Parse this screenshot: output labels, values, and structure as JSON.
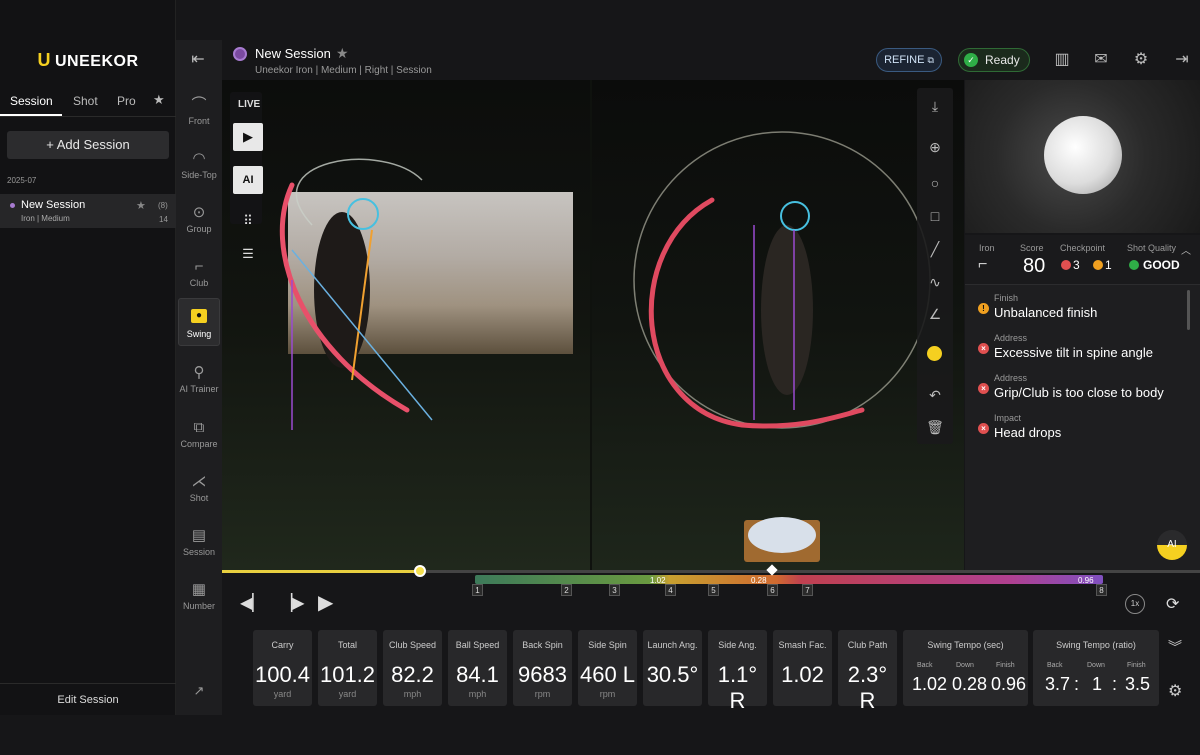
{
  "logo": {
    "mark": "U",
    "text": "UNEEKOR"
  },
  "left_tabs": [
    "Session",
    "Shot",
    "Pro"
  ],
  "add_session": "+ Add Session",
  "date_group": "2025-07",
  "session_item": {
    "title": "New Session",
    "sub": "Iron | Medium",
    "count_top": "(8)",
    "count_bottom": "14"
  },
  "edit_session": "Edit Session",
  "nav": [
    {
      "label": "Front",
      "icon": "front-view-icon"
    },
    {
      "label": "Side-Top",
      "icon": "side-top-view-icon"
    },
    {
      "label": "Group",
      "icon": "group-icon"
    },
    {
      "label": "Club",
      "icon": "club-icon"
    },
    {
      "label": "Swing",
      "icon": "camera-icon"
    },
    {
      "label": "AI Trainer",
      "icon": "ai-trainer-icon"
    },
    {
      "label": "Compare",
      "icon": "compare-icon"
    },
    {
      "label": "Shot",
      "icon": "shot-icon"
    },
    {
      "label": "Session",
      "icon": "session-icon"
    },
    {
      "label": "Number",
      "icon": "number-icon"
    }
  ],
  "header": {
    "title": "New Session",
    "subtitle": "Uneekor   Iron | Medium | Right | Session",
    "refine": "REFINE",
    "ready": "Ready"
  },
  "video": {
    "live": "LIVE",
    "ai": "AI"
  },
  "score": {
    "club_label": "Iron",
    "score_label": "Score",
    "score": "80",
    "checkpoint_label": "Checkpoint",
    "checkpoint_err": "3",
    "checkpoint_warn": "1",
    "quality_label": "Shot Quality",
    "quality": "GOOD"
  },
  "checkpoints": [
    {
      "cat": "Finish",
      "text": "Unbalanced finish",
      "level": "warn"
    },
    {
      "cat": "Address",
      "text": "Excessive tilt in spine angle",
      "level": "err"
    },
    {
      "cat": "Address",
      "text": "Grip/Club is too close to body",
      "level": "err"
    },
    {
      "cat": "Impact",
      "text": "Head drops",
      "level": "err"
    }
  ],
  "ai_button": "AI",
  "timeline": {
    "phase_labels": [
      "1.02",
      "0.28",
      "0.96"
    ],
    "phase_numbers": [
      "1",
      "2",
      "3",
      "4",
      "5",
      "6",
      "7",
      "8"
    ],
    "speed": "1x"
  },
  "metrics": [
    {
      "label": "Carry",
      "value": "100.4",
      "unit": "yard"
    },
    {
      "label": "Total",
      "value": "101.2",
      "unit": "yard"
    },
    {
      "label": "Club Speed",
      "value": "82.2",
      "unit": "mph"
    },
    {
      "label": "Ball Speed",
      "value": "84.1",
      "unit": "mph"
    },
    {
      "label": "Back Spin",
      "value": "9683",
      "unit": "rpm"
    },
    {
      "label": "Side Spin",
      "value": "460 L",
      "unit": "rpm"
    },
    {
      "label": "Launch Ang.",
      "value": "30.5°",
      "unit": ""
    },
    {
      "label": "Side Ang.",
      "value": "1.1° R",
      "unit": ""
    },
    {
      "label": "Smash Fac.",
      "value": "1.02",
      "unit": ""
    },
    {
      "label": "Club Path",
      "value": "2.3° R",
      "unit": ""
    }
  ],
  "tempo_sec": {
    "label": "Swing Tempo (sec)",
    "back_label": "Back",
    "down_label": "Down",
    "finish_label": "Finish",
    "back": "1.02",
    "down": "0.28",
    "finish": "0.96"
  },
  "tempo_ratio": {
    "label": "Swing Tempo (ratio)",
    "back_label": "Back",
    "down_label": "Down",
    "finish_label": "Finish",
    "back": "3.7",
    "down": "1",
    "finish": "3.5",
    "sep": ":"
  },
  "colors": {
    "accent": "#f5d020",
    "ready": "#2fae47",
    "warn": "#f0a020",
    "error": "#e05050"
  }
}
